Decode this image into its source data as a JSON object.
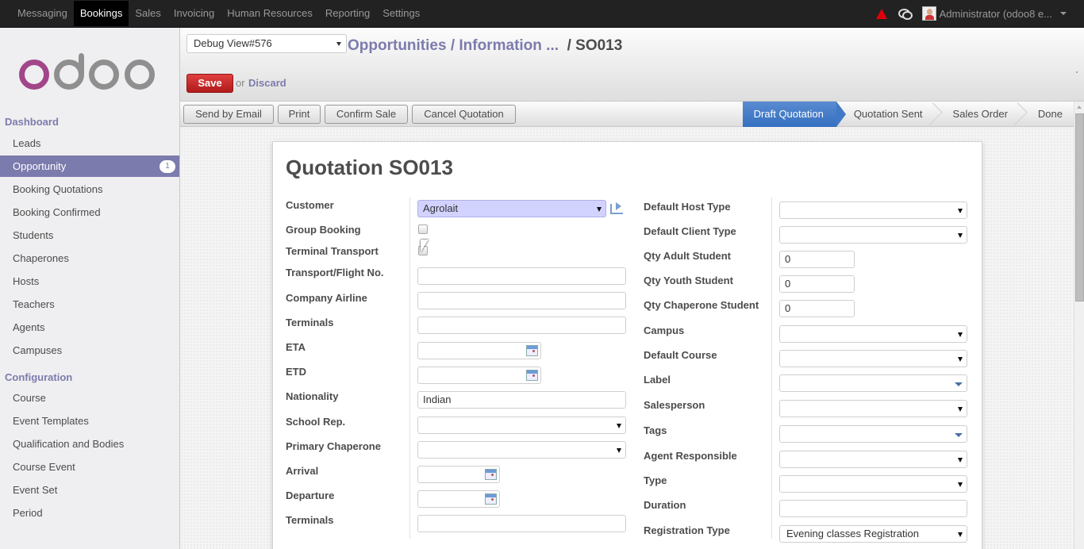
{
  "topbar": {
    "menu": [
      "Messaging",
      "Bookings",
      "Sales",
      "Invoicing",
      "Human Resources",
      "Reporting",
      "Settings"
    ],
    "active_menu": "Bookings",
    "icons": [
      "warning-icon",
      "chat-icon"
    ],
    "user_label": "Administrator (odoo8  e..."
  },
  "sidebar": {
    "logo_text": "odoo",
    "sections": [
      {
        "title": "Dashboard",
        "items": [
          {
            "label": "Leads"
          },
          {
            "label": "Opportunity",
            "active": true,
            "badge": "1"
          },
          {
            "label": "Booking Quotations"
          },
          {
            "label": "Booking Confirmed"
          },
          {
            "label": "Students"
          },
          {
            "label": "Chaperones"
          },
          {
            "label": "Hosts"
          },
          {
            "label": "Teachers"
          },
          {
            "label": "Agents"
          },
          {
            "label": "Campuses"
          }
        ]
      },
      {
        "title": "Configuration",
        "items": [
          {
            "label": "Course"
          },
          {
            "label": "Event Templates"
          },
          {
            "label": "Qualification and Bodies"
          },
          {
            "label": "Course Event"
          },
          {
            "label": "Event Set"
          },
          {
            "label": "Period"
          }
        ]
      }
    ]
  },
  "header": {
    "debug_select": "Debug View#576",
    "breadcrumb": {
      "link1": "Opportunities",
      "sep1": " / ",
      "link2": "Information ...",
      "sep2": "  / ",
      "current": "SO013"
    },
    "save_label": "Save",
    "or_label": "or",
    "discard_label": "Discard"
  },
  "statusbar": {
    "buttons": [
      "Send by Email",
      "Print",
      "Confirm Sale",
      "Cancel Quotation"
    ],
    "stages": [
      "Draft Quotation",
      "Quotation Sent",
      "Sales Order",
      "Done"
    ],
    "active_stage": "Draft Quotation"
  },
  "form": {
    "title": "Quotation SO013",
    "left": [
      {
        "label": "Customer",
        "type": "many2one",
        "value": "Agrolait"
      },
      {
        "label": "Group Booking",
        "type": "checkbox",
        "value": false
      },
      {
        "label": "Terminal Transport",
        "type": "checkbox",
        "value": false
      },
      {
        "label": "Transport/Flight No.",
        "type": "text",
        "value": ""
      },
      {
        "label": "Company Airline",
        "type": "text",
        "value": ""
      },
      {
        "label": "Terminals",
        "type": "text",
        "value": ""
      },
      {
        "label": "ETA",
        "type": "datetime",
        "value": ""
      },
      {
        "label": "ETD",
        "type": "datetime",
        "value": ""
      },
      {
        "label": "Nationality",
        "type": "text",
        "value": "Indian"
      },
      {
        "label": "School Rep.",
        "type": "select",
        "value": ""
      },
      {
        "label": "Primary Chaperone",
        "type": "select",
        "value": ""
      },
      {
        "label": "Arrival",
        "type": "date",
        "value": ""
      },
      {
        "label": "Departure",
        "type": "date",
        "value": ""
      },
      {
        "label": "Terminals",
        "type": "text",
        "value": ""
      }
    ],
    "right": [
      {
        "label": "Default Host Type",
        "type": "select",
        "value": ""
      },
      {
        "label": "Default Client Type",
        "type": "select",
        "value": ""
      },
      {
        "label": "Qty Adult Student",
        "type": "number",
        "value": "0"
      },
      {
        "label": "Qty Youth Student",
        "type": "number",
        "value": "0"
      },
      {
        "label": "Qty Chaperone Student",
        "type": "number",
        "value": "0"
      },
      {
        "label": "Campus",
        "type": "select",
        "value": ""
      },
      {
        "label": "Default Course",
        "type": "select",
        "value": ""
      },
      {
        "label": "Label",
        "type": "tags",
        "value": ""
      },
      {
        "label": "Salesperson",
        "type": "select",
        "value": ""
      },
      {
        "label": "Tags",
        "type": "tags",
        "value": ""
      },
      {
        "label": "Agent Responsible",
        "type": "select",
        "value": ""
      },
      {
        "label": "Type",
        "type": "select",
        "value": ""
      },
      {
        "label": "Duration",
        "type": "text",
        "value": ""
      },
      {
        "label": "Registration Type",
        "type": "select",
        "value": "Evening classes Registration"
      }
    ]
  }
}
